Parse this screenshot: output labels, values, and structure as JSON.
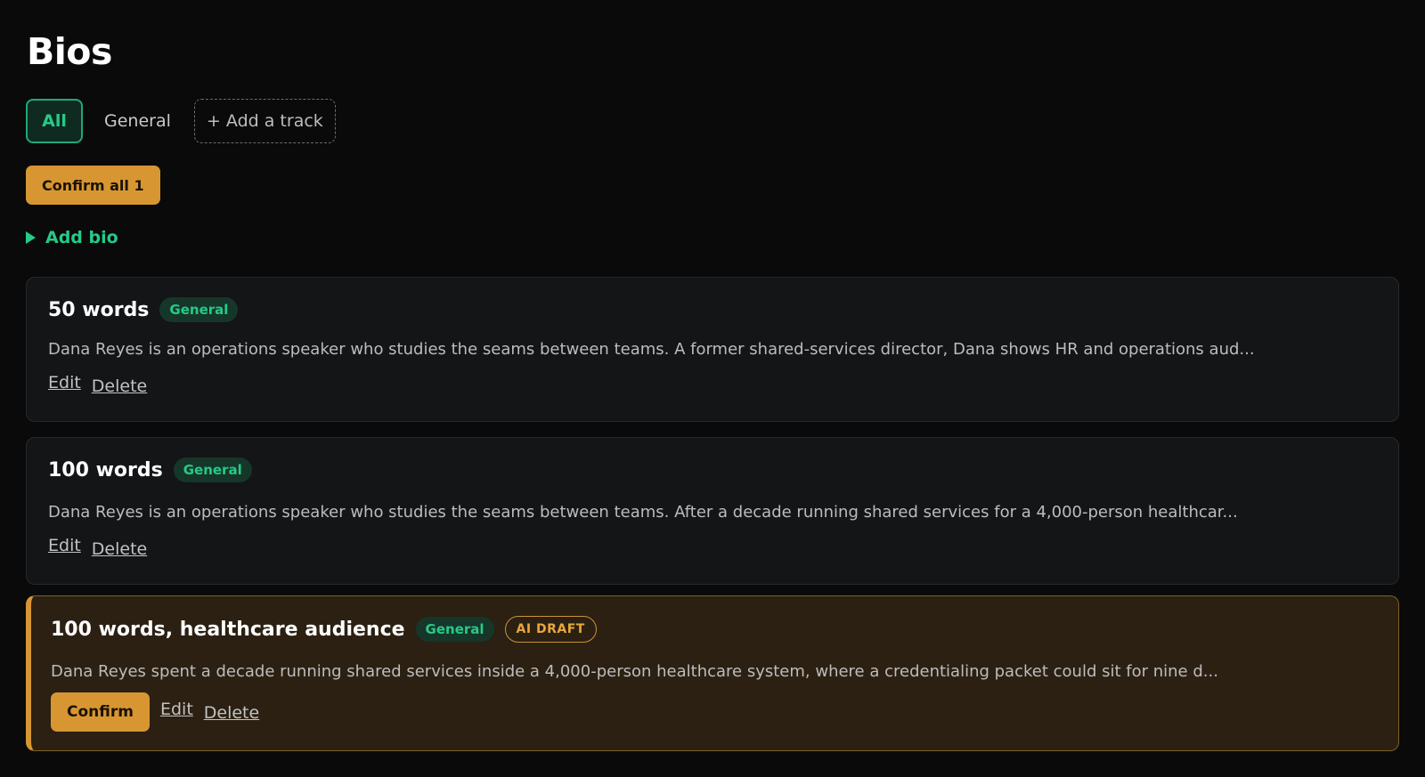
{
  "page": {
    "title": "Bios"
  },
  "tabs": {
    "all": "All",
    "general": "General",
    "add_track": "+ Add a track"
  },
  "toolbar": {
    "confirm_all": "Confirm all 1"
  },
  "add_bio": {
    "label": "Add bio"
  },
  "bios": [
    {
      "title": "50 words",
      "tag": "General",
      "text": "Dana Reyes is an operations speaker who studies the seams between teams. A former shared-services director, Dana shows HR and operations aud...",
      "edit": "Edit",
      "delete": "Delete"
    },
    {
      "title": "100 words",
      "tag": "General",
      "text": "Dana Reyes is an operations speaker who studies the seams between teams. After a decade running shared services for a 4,000-person healthcar...",
      "edit": "Edit",
      "delete": "Delete"
    },
    {
      "title": "100 words, healthcare audience",
      "tag": "General",
      "badge": "AI DRAFT",
      "text": "Dana Reyes spent a decade running shared services inside a 4,000-person healthcare system, where a credentialing packet could sit for nine d...",
      "confirm": "Confirm",
      "edit": "Edit",
      "delete": "Delete"
    }
  ],
  "colors": {
    "accent_green": "#27c987",
    "accent_amber": "#d89632",
    "background": "#0a0a0a"
  }
}
